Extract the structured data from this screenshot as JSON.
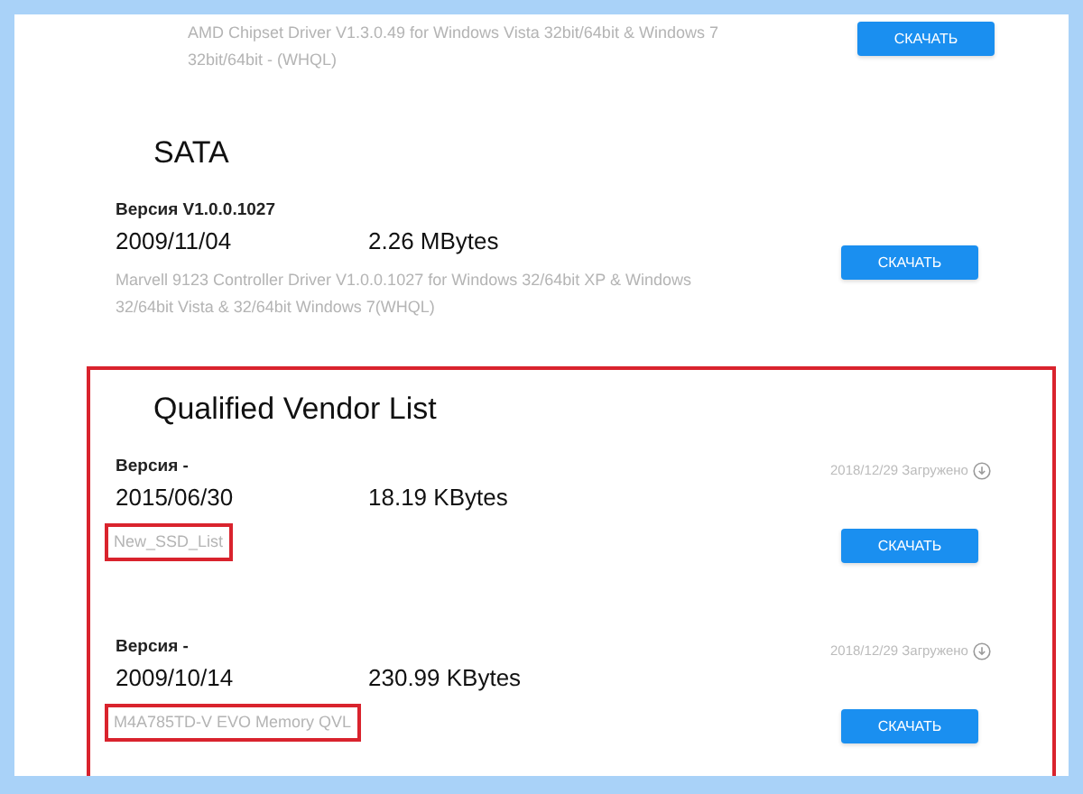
{
  "top_item": {
    "description": "AMD Chipset Driver V1.3.0.49 for Windows Vista 32bit/64bit & Windows 7 32bit/64bit - (WHQL)",
    "button": "СКАЧАТЬ"
  },
  "sections": [
    {
      "title": "SATA",
      "highlighted": false,
      "items": [
        {
          "version": "Версия V1.0.0.1027",
          "date": "2009/11/04",
          "size": "2.26 MBytes",
          "description": "Marvell 9123 Controller Driver V1.0.0.1027 for Windows 32/64bit XP & Windows 32/64bit Vista & 32/64bit Windows 7(WHQL)",
          "description_highlighted": false,
          "button": "СКАЧАТЬ"
        }
      ]
    },
    {
      "title": "Qualified Vendor List",
      "highlighted": true,
      "items": [
        {
          "version": "Версия -",
          "date": "2015/06/30",
          "size": "18.19 KBytes",
          "description": "New_SSD_List",
          "description_highlighted": true,
          "uploaded": "2018/12/29 Загружено",
          "button": "СКАЧАТЬ"
        },
        {
          "version": "Версия -",
          "date": "2009/10/14",
          "size": "230.99 KBytes",
          "description": "M4A785TD-V EVO Memory QVL",
          "description_highlighted": true,
          "uploaded": "2018/12/29 Загружено",
          "button": "СКАЧАТЬ"
        }
      ]
    }
  ]
}
